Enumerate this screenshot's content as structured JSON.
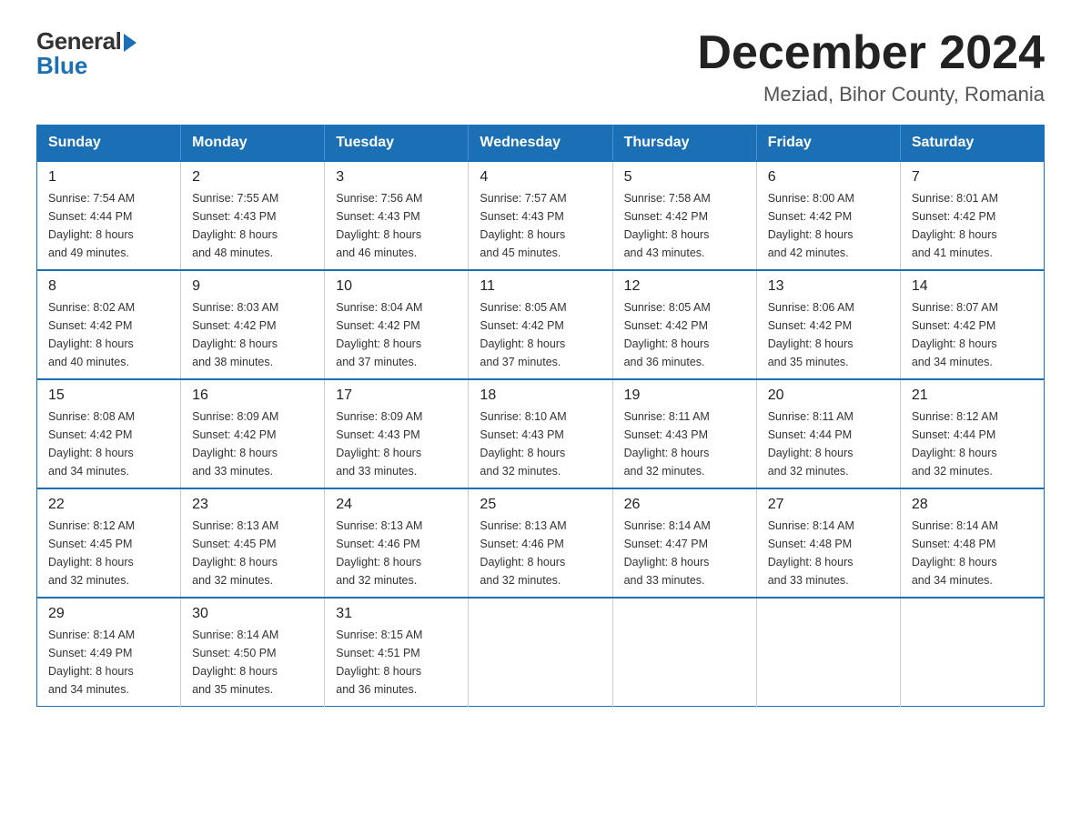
{
  "logo": {
    "general": "General",
    "blue": "Blue"
  },
  "title": {
    "month_year": "December 2024",
    "location": "Meziad, Bihor County, Romania"
  },
  "weekdays": [
    "Sunday",
    "Monday",
    "Tuesday",
    "Wednesday",
    "Thursday",
    "Friday",
    "Saturday"
  ],
  "weeks": [
    [
      {
        "day": "1",
        "sunrise": "7:54 AM",
        "sunset": "4:44 PM",
        "daylight": "8 hours and 49 minutes."
      },
      {
        "day": "2",
        "sunrise": "7:55 AM",
        "sunset": "4:43 PM",
        "daylight": "8 hours and 48 minutes."
      },
      {
        "day": "3",
        "sunrise": "7:56 AM",
        "sunset": "4:43 PM",
        "daylight": "8 hours and 46 minutes."
      },
      {
        "day": "4",
        "sunrise": "7:57 AM",
        "sunset": "4:43 PM",
        "daylight": "8 hours and 45 minutes."
      },
      {
        "day": "5",
        "sunrise": "7:58 AM",
        "sunset": "4:42 PM",
        "daylight": "8 hours and 43 minutes."
      },
      {
        "day": "6",
        "sunrise": "8:00 AM",
        "sunset": "4:42 PM",
        "daylight": "8 hours and 42 minutes."
      },
      {
        "day": "7",
        "sunrise": "8:01 AM",
        "sunset": "4:42 PM",
        "daylight": "8 hours and 41 minutes."
      }
    ],
    [
      {
        "day": "8",
        "sunrise": "8:02 AM",
        "sunset": "4:42 PM",
        "daylight": "8 hours and 40 minutes."
      },
      {
        "day": "9",
        "sunrise": "8:03 AM",
        "sunset": "4:42 PM",
        "daylight": "8 hours and 38 minutes."
      },
      {
        "day": "10",
        "sunrise": "8:04 AM",
        "sunset": "4:42 PM",
        "daylight": "8 hours and 37 minutes."
      },
      {
        "day": "11",
        "sunrise": "8:05 AM",
        "sunset": "4:42 PM",
        "daylight": "8 hours and 37 minutes."
      },
      {
        "day": "12",
        "sunrise": "8:05 AM",
        "sunset": "4:42 PM",
        "daylight": "8 hours and 36 minutes."
      },
      {
        "day": "13",
        "sunrise": "8:06 AM",
        "sunset": "4:42 PM",
        "daylight": "8 hours and 35 minutes."
      },
      {
        "day": "14",
        "sunrise": "8:07 AM",
        "sunset": "4:42 PM",
        "daylight": "8 hours and 34 minutes."
      }
    ],
    [
      {
        "day": "15",
        "sunrise": "8:08 AM",
        "sunset": "4:42 PM",
        "daylight": "8 hours and 34 minutes."
      },
      {
        "day": "16",
        "sunrise": "8:09 AM",
        "sunset": "4:42 PM",
        "daylight": "8 hours and 33 minutes."
      },
      {
        "day": "17",
        "sunrise": "8:09 AM",
        "sunset": "4:43 PM",
        "daylight": "8 hours and 33 minutes."
      },
      {
        "day": "18",
        "sunrise": "8:10 AM",
        "sunset": "4:43 PM",
        "daylight": "8 hours and 32 minutes."
      },
      {
        "day": "19",
        "sunrise": "8:11 AM",
        "sunset": "4:43 PM",
        "daylight": "8 hours and 32 minutes."
      },
      {
        "day": "20",
        "sunrise": "8:11 AM",
        "sunset": "4:44 PM",
        "daylight": "8 hours and 32 minutes."
      },
      {
        "day": "21",
        "sunrise": "8:12 AM",
        "sunset": "4:44 PM",
        "daylight": "8 hours and 32 minutes."
      }
    ],
    [
      {
        "day": "22",
        "sunrise": "8:12 AM",
        "sunset": "4:45 PM",
        "daylight": "8 hours and 32 minutes."
      },
      {
        "day": "23",
        "sunrise": "8:13 AM",
        "sunset": "4:45 PM",
        "daylight": "8 hours and 32 minutes."
      },
      {
        "day": "24",
        "sunrise": "8:13 AM",
        "sunset": "4:46 PM",
        "daylight": "8 hours and 32 minutes."
      },
      {
        "day": "25",
        "sunrise": "8:13 AM",
        "sunset": "4:46 PM",
        "daylight": "8 hours and 32 minutes."
      },
      {
        "day": "26",
        "sunrise": "8:14 AM",
        "sunset": "4:47 PM",
        "daylight": "8 hours and 33 minutes."
      },
      {
        "day": "27",
        "sunrise": "8:14 AM",
        "sunset": "4:48 PM",
        "daylight": "8 hours and 33 minutes."
      },
      {
        "day": "28",
        "sunrise": "8:14 AM",
        "sunset": "4:48 PM",
        "daylight": "8 hours and 34 minutes."
      }
    ],
    [
      {
        "day": "29",
        "sunrise": "8:14 AM",
        "sunset": "4:49 PM",
        "daylight": "8 hours and 34 minutes."
      },
      {
        "day": "30",
        "sunrise": "8:14 AM",
        "sunset": "4:50 PM",
        "daylight": "8 hours and 35 minutes."
      },
      {
        "day": "31",
        "sunrise": "8:15 AM",
        "sunset": "4:51 PM",
        "daylight": "8 hours and 36 minutes."
      },
      null,
      null,
      null,
      null
    ]
  ],
  "labels": {
    "sunrise": "Sunrise:",
    "sunset": "Sunset:",
    "daylight": "Daylight:"
  }
}
